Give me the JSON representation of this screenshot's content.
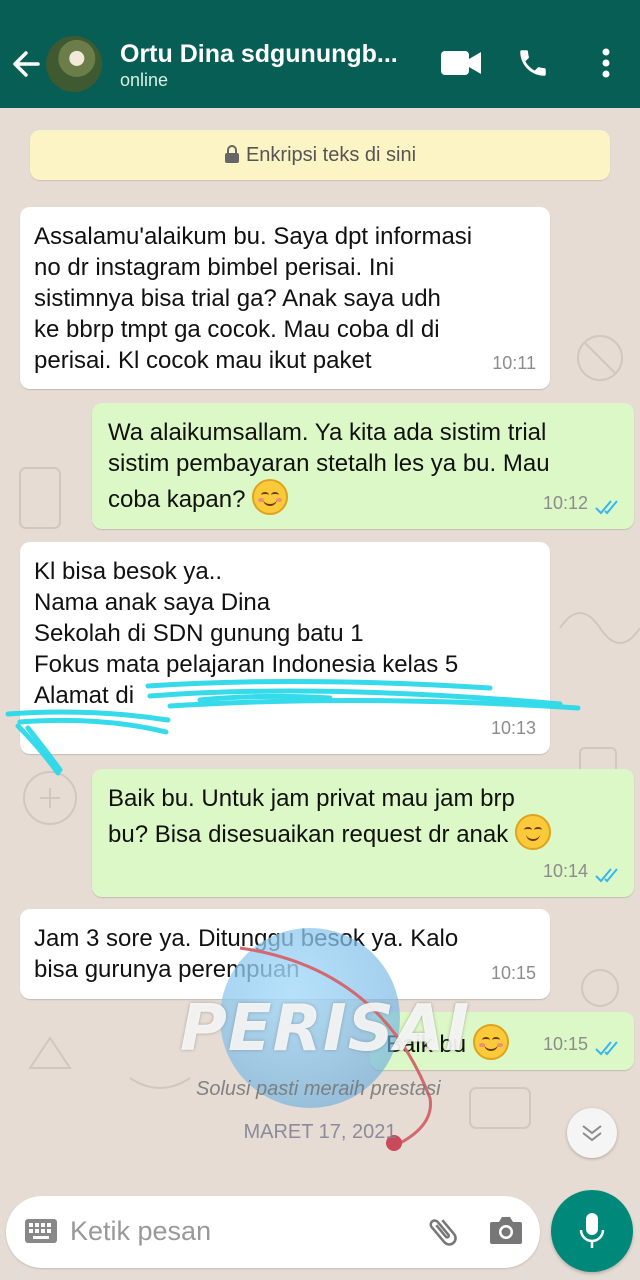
{
  "header": {
    "contact_name": "Ortu Dina sdgunungb...",
    "status": "online",
    "icons": [
      "back-arrow-icon",
      "video-call-icon",
      "phone-icon",
      "more-vertical-icon"
    ]
  },
  "chat": {
    "encryption_notice": "Enkripsi teks di sini",
    "messages": [
      {
        "direction": "in",
        "text": "Assalamu'alaikum bu. Saya dpt informasi\nno dr instagram bimbel perisai. Ini\nsistimnya bisa trial ga? Anak saya udh\nke bbrp tmpt ga cocok. Mau coba dl di\nperisai. Kl cocok mau ikut paket",
        "time": "10:11"
      },
      {
        "direction": "out",
        "text": "Wa alaikumsallam. Ya kita ada sistim trial\nsistim pembayaran stetalh les ya bu. Mau\ncoba kapan?",
        "emoji": "relieved-face",
        "time": "10:12",
        "read": true
      },
      {
        "direction": "in",
        "text": "Kl bisa besok ya..\nNama anak saya Dina\nSekolah di SDN gunung batu 1\nFokus mata pelajaran Indonesia kelas 5\nAlamat di",
        "time": "10:13"
      },
      {
        "direction": "out",
        "text": "Baik bu. Untuk jam privat mau jam brp\nbu? Bisa disesuaikan request dr anak",
        "emoji": "smiling-face",
        "time": "10:14",
        "read": true
      },
      {
        "direction": "in",
        "text": "Jam 3 sore ya. Ditunggu besok ya. Kalo\nbisa gurunya perempuan",
        "time": "10:15"
      },
      {
        "direction": "out",
        "text": "Baik bu",
        "emoji": "relieved-face",
        "time": "10:15",
        "read": true
      }
    ]
  },
  "watermark": {
    "brand": "PERISAI",
    "tagline": "Solusi pasti meraih prestasi",
    "date": "MARET 17, 2021"
  },
  "composer": {
    "placeholder": "Ketik pesan",
    "icons": [
      "keyboard-icon",
      "attach-icon",
      "camera-icon",
      "mic-icon"
    ]
  },
  "colors": {
    "header": "#075e54",
    "incoming_bubble": "#ffffff",
    "outgoing_bubble": "#dcf8c6",
    "read_ticks": "#34b7f1",
    "mic_button": "#00897b",
    "encryption_banner": "#fcf4c4"
  }
}
